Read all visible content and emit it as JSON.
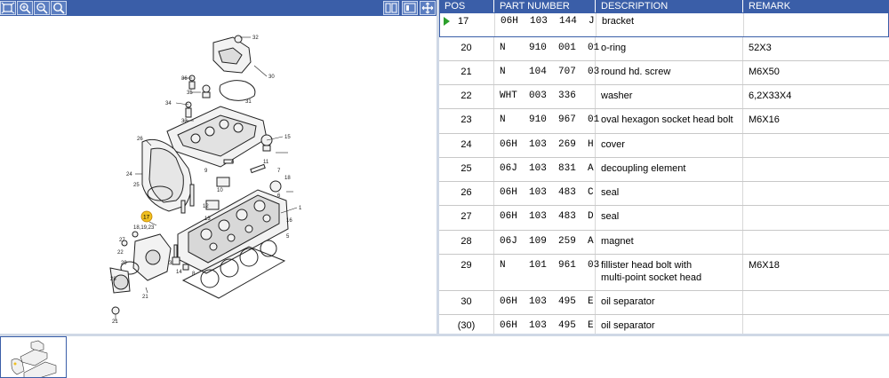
{
  "toolbar": {
    "left_icons": [
      "zoom-fit-icon",
      "zoom-in-icon",
      "zoom-out-icon",
      "magnifier-icon"
    ],
    "right_icons": [
      "split-view-icon",
      "single-view-icon",
      "move-icon"
    ]
  },
  "diagram": {
    "callouts": [
      "32",
      "30",
      "36",
      "35",
      "34",
      "33",
      "31",
      "26",
      "24",
      "25",
      "15",
      "18",
      "17",
      "2",
      "12",
      "13",
      "19",
      "1",
      "16",
      "17",
      "18,19,23",
      "27",
      "22",
      "29",
      "28",
      "21",
      "20",
      "3",
      "14",
      "22",
      "8",
      "10",
      "9",
      "4",
      "11",
      "7",
      "6",
      "5"
    ],
    "highlighted_callout": "17"
  },
  "table": {
    "headers": {
      "pos": "POS",
      "part_number": "PART NUMBER",
      "description": "DESCRIPTION",
      "remark": "REMARK"
    },
    "selected_row": {
      "pos": "17",
      "part_number": "06H  103  144  J",
      "description": "bracket",
      "remark": ""
    },
    "rows": [
      {
        "pos": "20",
        "part_number": "N    910  001  01",
        "description": "o-ring",
        "remark": "52X3"
      },
      {
        "pos": "21",
        "part_number": "N    104  707  03",
        "description": "round hd. screw",
        "remark": "M6X50"
      },
      {
        "pos": "22",
        "part_number": "WHT  003  336",
        "description": "washer",
        "remark": "6,2X33X4"
      },
      {
        "pos": "23",
        "part_number": "N    910  967  01",
        "description": "oval hexagon socket head bolt",
        "remark": "M6X16"
      },
      {
        "pos": "24",
        "part_number": "06H  103  269  H",
        "description": "cover",
        "remark": ""
      },
      {
        "pos": "25",
        "part_number": "06J  103  831  A",
        "description": "decoupling element",
        "remark": ""
      },
      {
        "pos": "26",
        "part_number": "06H  103  483  C",
        "description": "seal",
        "remark": ""
      },
      {
        "pos": "27",
        "part_number": "06H  103  483  D",
        "description": "seal",
        "remark": ""
      },
      {
        "pos": "28",
        "part_number": "06J  109  259  A",
        "description": "magnet",
        "remark": ""
      },
      {
        "pos": "29",
        "part_number": "N    101  961  03",
        "description": "fillister head bolt with",
        "description2": "multi-point socket head",
        "remark": "M6X18"
      },
      {
        "pos": "30",
        "part_number": "06H  103  495  E",
        "description": "oil separator",
        "remark": ""
      },
      {
        "pos": "(30)",
        "part_number": "06H  103  495  E",
        "description": "oil separator",
        "remark": ""
      }
    ]
  },
  "colors": {
    "header_bg": "#3a5ea8",
    "selection_arrow": "#2ca02c",
    "callout_highlight": "#f0c020"
  }
}
